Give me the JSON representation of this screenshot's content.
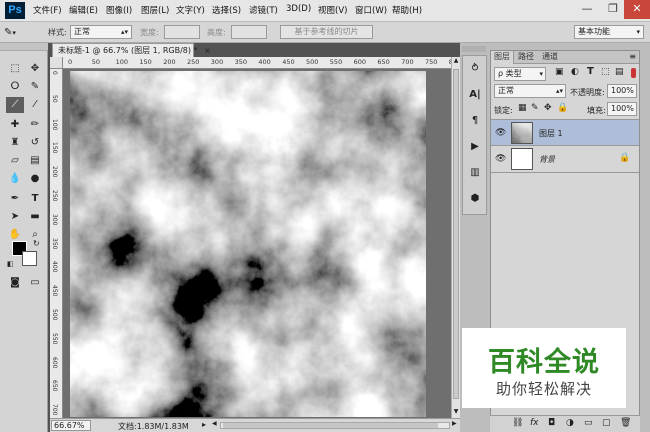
{
  "app": {
    "logo": "Ps"
  },
  "menubar": {
    "items": [
      "文件(F)",
      "编辑(E)",
      "图像(I)",
      "图层(L)",
      "文字(Y)",
      "选择(S)",
      "滤镜(T)",
      "3D(D)",
      "视图(V)",
      "窗口(W)",
      "帮助(H)"
    ]
  },
  "window_controls": {
    "minimize": "—",
    "restore": "❐",
    "close": "✕"
  },
  "options": {
    "style_label": "样式:",
    "style_value": "正常",
    "width_label": "宽度:",
    "height_label": "高度:",
    "slice_button": "基于参考线的切片",
    "workspace_value": "基本功能"
  },
  "document": {
    "tab_title": "未标题-1 @ 66.7% (图层 1, RGB/8) *",
    "ruler_h": [
      "0",
      "50",
      "100",
      "150",
      "200",
      "250",
      "300",
      "350",
      "400",
      "450",
      "500",
      "550",
      "600",
      "650",
      "700",
      "750",
      "800"
    ],
    "ruler_v": [
      "0",
      "50",
      "100",
      "150",
      "200",
      "250",
      "300",
      "350",
      "400",
      "450",
      "500",
      "550",
      "600",
      "650",
      "700"
    ],
    "zoom": "66.67%",
    "doc_info": "文档:1.83M/1.83M"
  },
  "layers_panel": {
    "tabs": [
      "图层",
      "路径",
      "通道"
    ],
    "filter_kind": "ρ 类型",
    "blend_mode": "正常",
    "opacity_label": "不透明度:",
    "opacity_value": "100%",
    "lock_label": "锁定:",
    "fill_label": "填充:",
    "fill_value": "100%",
    "layers": [
      {
        "name": "图层 1",
        "selected": true
      },
      {
        "name": "背景",
        "locked": true
      }
    ],
    "bottom_icons": [
      "link-icon",
      "fx-icon",
      "mask-icon",
      "adjustment-icon",
      "group-icon",
      "new-layer-icon",
      "delete-icon"
    ]
  },
  "watermark": {
    "title": "百科全说",
    "subtitle": "助你轻松解决"
  },
  "colors": {
    "accent_selected": "#aebdd8",
    "brand": "#31a8ff",
    "watermark_green": "#2f8a26"
  }
}
